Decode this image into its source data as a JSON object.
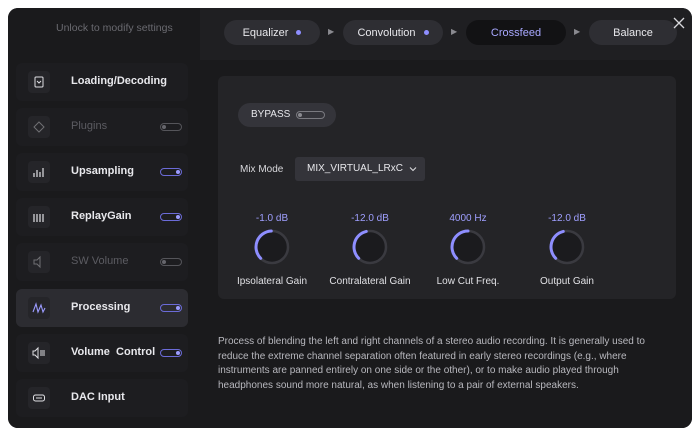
{
  "sidebar": {
    "unlock_text": "Unlock to modify settings",
    "items": [
      {
        "label": "Loading/Decoding",
        "icon": "file-decode-icon",
        "toggle": null,
        "disabled": false,
        "active": false
      },
      {
        "label": "Plugins",
        "icon": "plugin-icon",
        "toggle": "off",
        "disabled": true,
        "active": false
      },
      {
        "label": "Upsampling",
        "icon": "upsampling-icon",
        "toggle": "on",
        "disabled": false,
        "active": false
      },
      {
        "label": "ReplayGain",
        "icon": "bars-icon",
        "toggle": "on",
        "disabled": false,
        "active": false
      },
      {
        "label": "SW Volume",
        "icon": "speaker-icon",
        "toggle": "off",
        "disabled": true,
        "active": false
      },
      {
        "label": "Processing",
        "icon": "waveform-icon",
        "toggle": "on",
        "disabled": false,
        "active": true
      },
      {
        "label": "Volume  Control",
        "icon": "volume-control-icon",
        "toggle": "on",
        "disabled": false,
        "active": false
      },
      {
        "label": "DAC Input",
        "icon": "dac-icon",
        "toggle": null,
        "disabled": false,
        "active": false
      }
    ]
  },
  "pipeline": {
    "steps": [
      {
        "label": "Equalizer",
        "dot": true,
        "active": false
      },
      {
        "label": "Convolution",
        "dot": true,
        "active": false
      },
      {
        "label": "Crossfeed",
        "dot": false,
        "active": true
      },
      {
        "label": "Balance",
        "dot": false,
        "active": false
      }
    ],
    "arrow_glyph": "▶"
  },
  "crossfeed": {
    "bypass_label": "BYPASS",
    "bypass_on": false,
    "mix_mode_label": "Mix Mode",
    "mix_mode_value": "MIX_VIRTUAL_LRxC",
    "knobs": [
      {
        "value": "-1.0 dB",
        "label": "Ipsolateral Gain",
        "level": 0.49
      },
      {
        "value": "-12.0 dB",
        "label": "Contralateral Gain",
        "level": 0.45
      },
      {
        "value": "4000 Hz",
        "label": "Low Cut Freq.",
        "level": 0.5
      },
      {
        "value": "-12.0 dB",
        "label": "Output Gain",
        "level": 0.45
      }
    ],
    "description": "Process of blending the left and right channels of a stereo audio recording. It is generally used to reduce the extreme channel separation often featured in early stereo recordings (e.g., where instruments are panned entirely on one side or the other), or to make audio played through headphones sound more natural, as when listening to a pair of external speakers."
  },
  "colors": {
    "accent": "#8e8eff",
    "background": "#171719",
    "panel": "#242427"
  }
}
